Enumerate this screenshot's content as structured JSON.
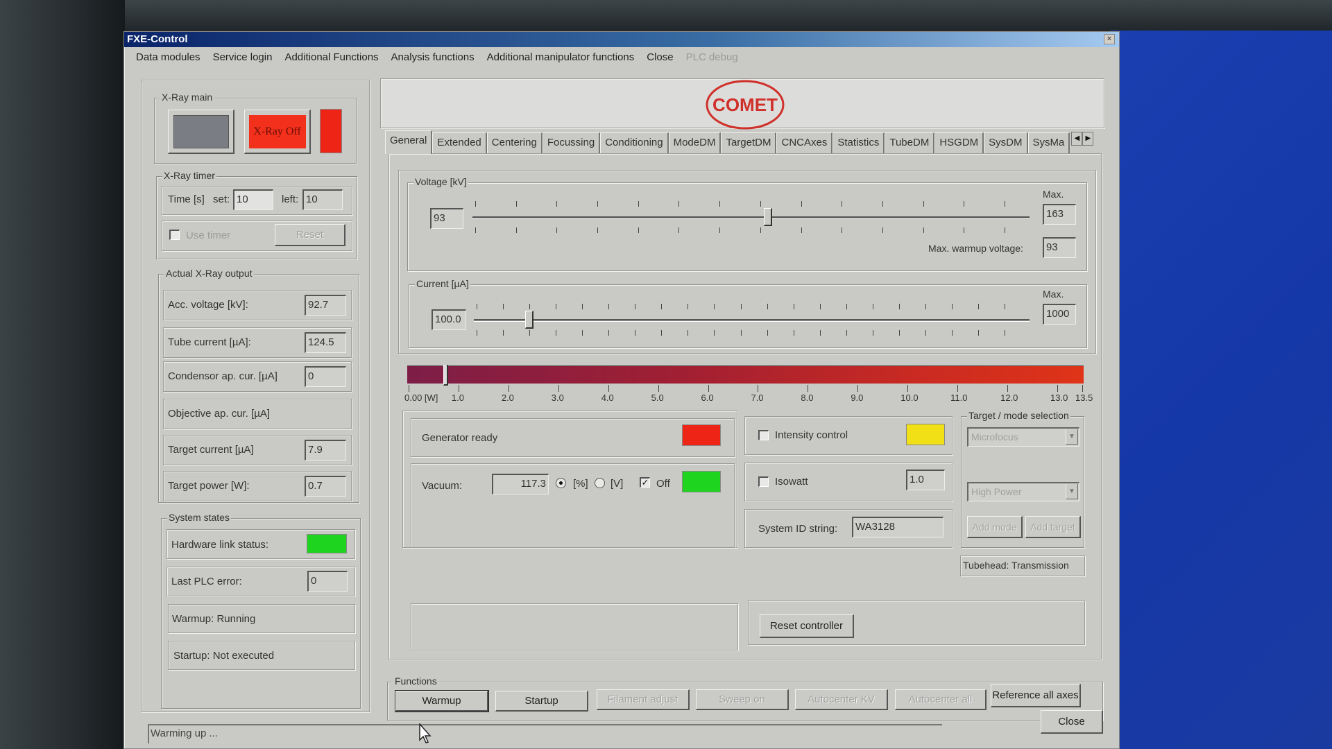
{
  "window": {
    "title": "FXE-Control",
    "close_glyph": "×"
  },
  "menu": [
    {
      "label": "Data modules",
      "enabled": true
    },
    {
      "label": "Service login",
      "enabled": true
    },
    {
      "label": "Additional Functions",
      "enabled": true
    },
    {
      "label": "Analysis functions",
      "enabled": true
    },
    {
      "label": "Additional manipulator functions",
      "enabled": true
    },
    {
      "label": "Close",
      "enabled": true
    },
    {
      "label": "PLC debug",
      "enabled": false
    }
  ],
  "left": {
    "xray_main": {
      "title": "X-Ray main",
      "xray_off_label": "X-Ray Off",
      "colors": {
        "gray_button": "#7a7d84",
        "off_button": "#f2301c",
        "indicator": "#ee2416"
      }
    },
    "xray_timer": {
      "title": "X-Ray timer",
      "time_label": "Time [s]",
      "set_label": "set:",
      "set_value": "10",
      "left_label": "left:",
      "left_value": "10",
      "use_timer_label": "Use timer",
      "use_timer_checked": false,
      "reset_label": "Reset"
    },
    "actual_output": {
      "title": "Actual X-Ray output",
      "rows": [
        {
          "label": "Acc. voltage [kV]:",
          "value": "92.7"
        },
        {
          "label": "Tube current [µA]:",
          "value": "124.5"
        },
        {
          "label": "Condensor ap. cur. [µA]",
          "value": "0"
        },
        {
          "label": "Objective ap. cur. [µA]",
          "value": null
        },
        {
          "label": "Target current [µA]",
          "value": "7.9"
        },
        {
          "label": "Target power [W]:",
          "value": "0.7"
        }
      ]
    },
    "system_states": {
      "title": "System states",
      "hardware_link_label": "Hardware link status:",
      "hardware_link_color": "#1fd41f",
      "last_plc_error_label": "Last PLC error:",
      "last_plc_error_value": "0",
      "warmup_status": "Warmup: Running",
      "startup_status": "Startup: Not executed"
    }
  },
  "logo": {
    "text": "COMET",
    "color": "#d0302a"
  },
  "tabs": {
    "items": [
      "General",
      "Extended",
      "Centering",
      "Focussing",
      "Conditioning",
      "ModeDM",
      "TargetDM",
      "CNCAxes",
      "Statistics",
      "TubeDM",
      "HSGDM",
      "SysDM",
      "SysMa"
    ],
    "active": "General",
    "scroll_left": "◀",
    "scroll_right": "▶"
  },
  "general": {
    "voltage": {
      "title": "Voltage [kV]",
      "value": "93",
      "slider_fraction": 0.53,
      "max_label": "Max.",
      "max_value": "163",
      "warmup_label": "Max. warmup voltage:",
      "warmup_value": "93"
    },
    "current": {
      "title": "Current [µA]",
      "value": "100.0",
      "slider_fraction": 0.1,
      "max_label": "Max.",
      "max_value": "1000"
    },
    "power_scale": {
      "unit_label": "0.00 [W]",
      "tick_labels": [
        "1.0",
        "2.0",
        "3.0",
        "4.0",
        "5.0",
        "6.0",
        "7.0",
        "8.0",
        "9.0",
        "10.0",
        "11.0",
        "12.0",
        "13.0",
        "13.5"
      ],
      "min": 0,
      "max": 13.5,
      "current_value": 0.7
    },
    "generator_ready": {
      "label": "Generator ready",
      "color": "#ee2416"
    },
    "vacuum": {
      "label": "Vacuum:",
      "value": "117.3",
      "unit_percent_label": "[%]",
      "unit_percent_selected": true,
      "unit_volt_label": "[V]",
      "unit_volt_selected": false,
      "off_label": "Off",
      "off_checked": true,
      "color": "#1fd41f"
    },
    "intensity_control": {
      "label": "Intensity control",
      "checked": false,
      "color": "#f0e015"
    },
    "isowatt": {
      "label": "Isowatt",
      "checked": false,
      "value": "1.0"
    },
    "system_id": {
      "label": "System ID string:",
      "value": "WA3128"
    },
    "target_mode": {
      "title": "Target / mode selection",
      "target_selected": "Microfocus",
      "mode_selected": "High Power",
      "add_mode_label": "Add mode",
      "add_target_label": "Add target"
    },
    "tubehead": "Tubehead: Transmission",
    "reset_controller_label": "Reset controller"
  },
  "functions": {
    "title": "Functions",
    "buttons": [
      {
        "label": "Warmup",
        "enabled": true
      },
      {
        "label": "Startup",
        "enabled": true
      },
      {
        "label": "Filament adjust",
        "enabled": false
      },
      {
        "label": "Sweep on",
        "enabled": false
      },
      {
        "label": "Autocenter KV",
        "enabled": false
      },
      {
        "label": "Autocenter all",
        "enabled": false
      },
      {
        "label": "Reference all axes",
        "enabled": true
      }
    ]
  },
  "close_button_label": "Close",
  "status_text": "Warming up ..."
}
